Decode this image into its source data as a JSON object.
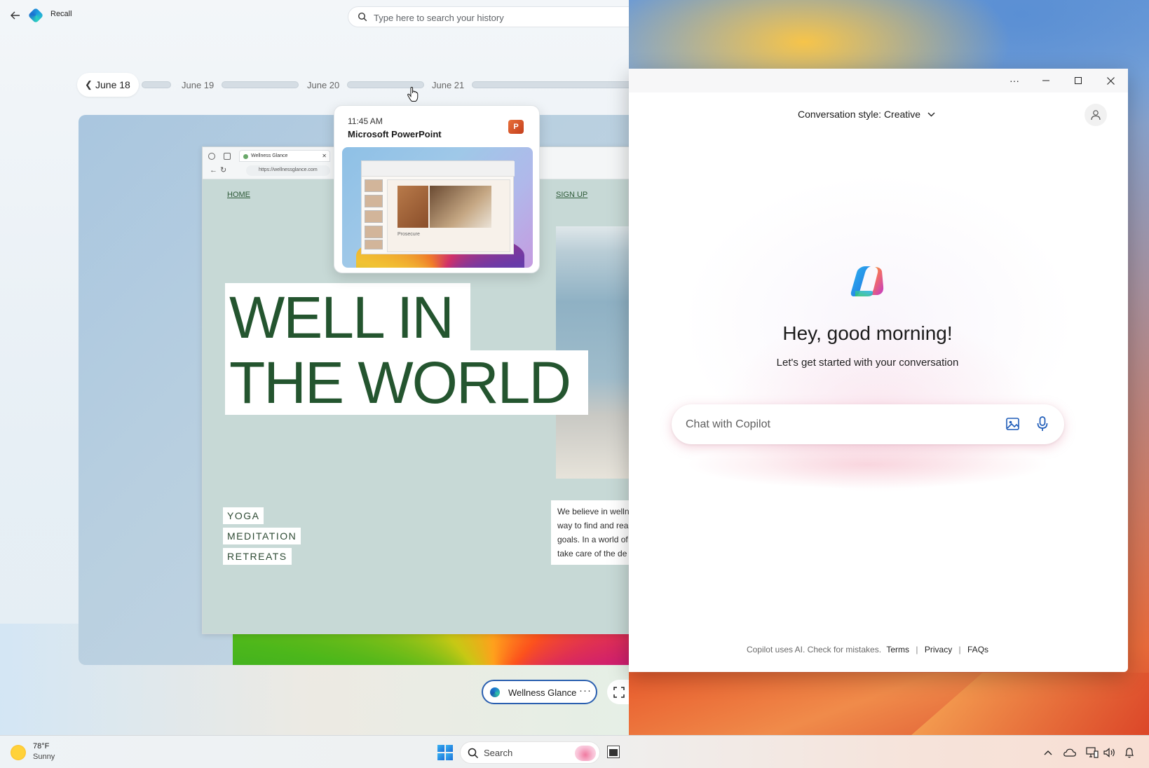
{
  "recall": {
    "app_title": "Recall",
    "search_placeholder": "Type here to search your history",
    "timeline": {
      "current_date": "June 18",
      "dates": [
        "June 19",
        "June 20",
        "June 21"
      ]
    },
    "popup": {
      "time": "11:45 AM",
      "app_name": "Microsoft PowerPoint",
      "thumb_caption": "Prosecure"
    },
    "snapshot": {
      "browser_tab": "Wellness Glance",
      "browser_url": "https://wellnessglance.com",
      "nav_home": "HOME",
      "nav_signup": "SIGN UP",
      "hero_line1": "WELL IN",
      "hero_line2": "THE WORLD",
      "tags": [
        "YOGA",
        "MEDITATION",
        "RETREATS"
      ],
      "blurb_lines": [
        "We believe in welln",
        "way to find and rea",
        "goals. In a world of",
        "take care of the de"
      ]
    },
    "app_pill_label": "Wellness Glance"
  },
  "copilot": {
    "conversation_style": "Conversation style: Creative",
    "greeting": "Hey, good morning!",
    "subgreeting": "Let's get started with your conversation",
    "chat_placeholder": "Chat with Copilot",
    "footer_text": "Copilot uses AI. Check for mistakes.",
    "footer_links": [
      "Terms",
      "Privacy",
      "FAQs"
    ]
  },
  "taskbar": {
    "weather_temp": "78°F",
    "weather_desc": "Sunny",
    "search_label": "Search"
  },
  "icons": {
    "ppt_letter": "P",
    "more": "···"
  },
  "colors": {
    "accent_blue": "#2a5fb0",
    "hero_green": "#24552f",
    "ppt_orange": "#c43e1c"
  }
}
